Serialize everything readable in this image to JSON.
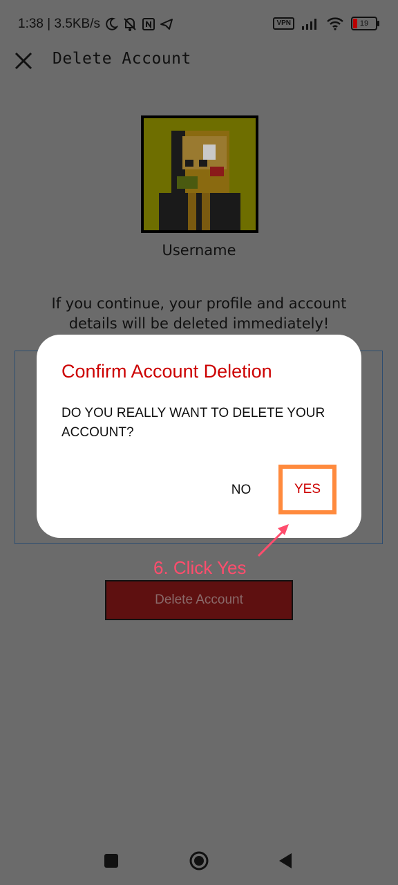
{
  "status_bar": {
    "left_text": "1:38 | 3.5KB/s",
    "vpn_label": "VPN",
    "battery_level": "19",
    "icons": [
      "moon-icon",
      "mute-icon",
      "nfc-icon",
      "telegram-icon",
      "vpn-icon",
      "signal-icon",
      "wifi-icon",
      "battery-icon"
    ]
  },
  "header": {
    "title": "Delete Account",
    "close_icon": "close-icon"
  },
  "profile": {
    "username": "Username"
  },
  "warning_text": "If you continue, your profile and account details will be deleted immediately!",
  "delete_button_label": "Delete Account",
  "dialog": {
    "title": "Confirm Account Deletion",
    "message": "DO YOU REALLY WANT TO DELETE YOUR ACCOUNT?",
    "no_label": "NO",
    "yes_label": "YES"
  },
  "annotation": {
    "text": "6. Click Yes",
    "color": "#ff4d6d"
  },
  "colors": {
    "overlay": "#6b6b6b",
    "dialog_title": "#cc0000",
    "highlight": "#ff8a3d",
    "delete_button": "#5e1010"
  }
}
